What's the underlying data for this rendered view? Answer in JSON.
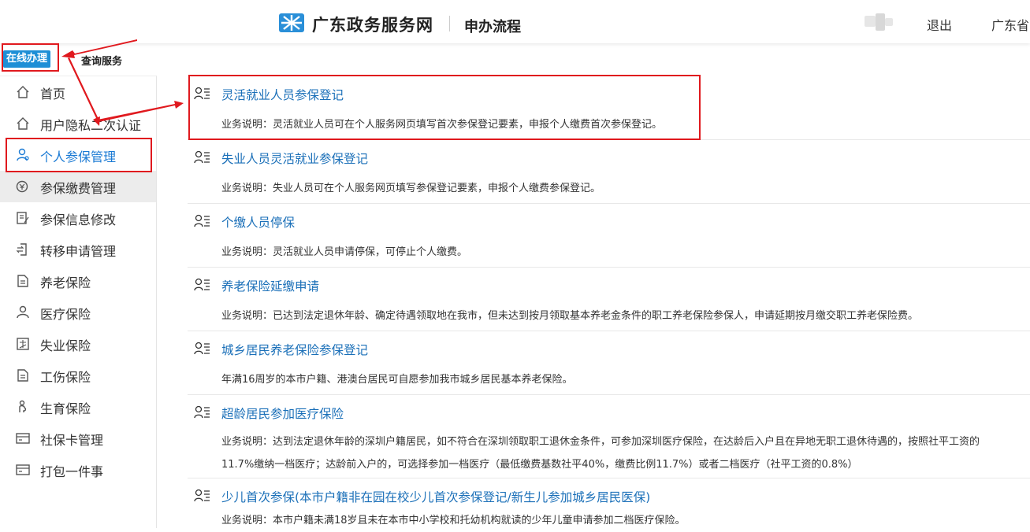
{
  "header": {
    "brand": "广东政务服务网",
    "page_name": "申办流程",
    "logout": "退出",
    "region": "广东省"
  },
  "tabs": {
    "online": "在线办理",
    "query": "查询服务"
  },
  "sidebar": {
    "items": [
      {
        "label": "首页",
        "icon": "home-icon"
      },
      {
        "label": "用户隐私二次认证",
        "icon": "user-shield-icon"
      },
      {
        "label": "个人参保管理",
        "icon": "person-settings-icon",
        "active": true
      },
      {
        "label": "参保缴费管理",
        "icon": "payment-icon"
      },
      {
        "label": "参保信息修改",
        "icon": "edit-doc-icon"
      },
      {
        "label": "转移申请管理",
        "icon": "transfer-icon"
      },
      {
        "label": "养老保险",
        "icon": "document-icon"
      },
      {
        "label": "医疗保险",
        "icon": "person-icon"
      },
      {
        "label": "失业保险",
        "icon": "unemployment-icon"
      },
      {
        "label": "工伤保险",
        "icon": "document-icon"
      },
      {
        "label": "生育保险",
        "icon": "maternity-icon"
      },
      {
        "label": "社保卡管理",
        "icon": "card-icon"
      },
      {
        "label": "打包一件事",
        "icon": "package-icon"
      }
    ]
  },
  "services": [
    {
      "title": "灵活就业人员参保登记",
      "desc": "业务说明：灵活就业人员可在个人服务网页填写首次参保登记要素，申报个人缴费首次参保登记。"
    },
    {
      "title": "失业人员灵活就业参保登记",
      "desc": "业务说明：失业人员可在个人服务网页填写参保登记要素，申报个人缴费参保登记。"
    },
    {
      "title": "个缴人员停保",
      "desc": "业务说明：灵活就业人员申请停保，可停止个人缴费。"
    },
    {
      "title": "养老保险延缴申请",
      "desc": "业务说明：已达到法定退休年龄、确定待遇领取地在我市，但未达到按月领取基本养老金条件的职工养老保险参保人，申请延期按月缴交职工养老保险费。"
    },
    {
      "title": "城乡居民养老保险参保登记",
      "desc": "年满16周岁的本市户籍、港澳台居民可自愿参加我市城乡居民基本养老保险。"
    },
    {
      "title": "超龄居民参加医疗保险",
      "desc": "业务说明：达到法定退休年龄的深圳户籍居民，如不符合在深圳领取职工退休金条件，可参加深圳医疗保险，在达龄后入户且在异地无职工退休待遇的，按照社平工资的11.7%缴纳一档医疗；达龄前入户的，可选择参加一档医疗（最低缴费基数社平40%，缴费比例11.7%）或者二档医疗（社平工资的0.8%）"
    },
    {
      "title": "少儿首次参保(本市户籍非在园在校少儿首次参保登记/新生儿参加城乡居民医保)",
      "desc": "业务说明：本市户籍未满18岁且未在本市中小学校和托幼机构就读的少年儿童申请参加二档医疗保险。"
    }
  ],
  "colors": {
    "accent": "#1e8fd6",
    "link": "#1a6fb8",
    "highlight": "#e0191e"
  }
}
